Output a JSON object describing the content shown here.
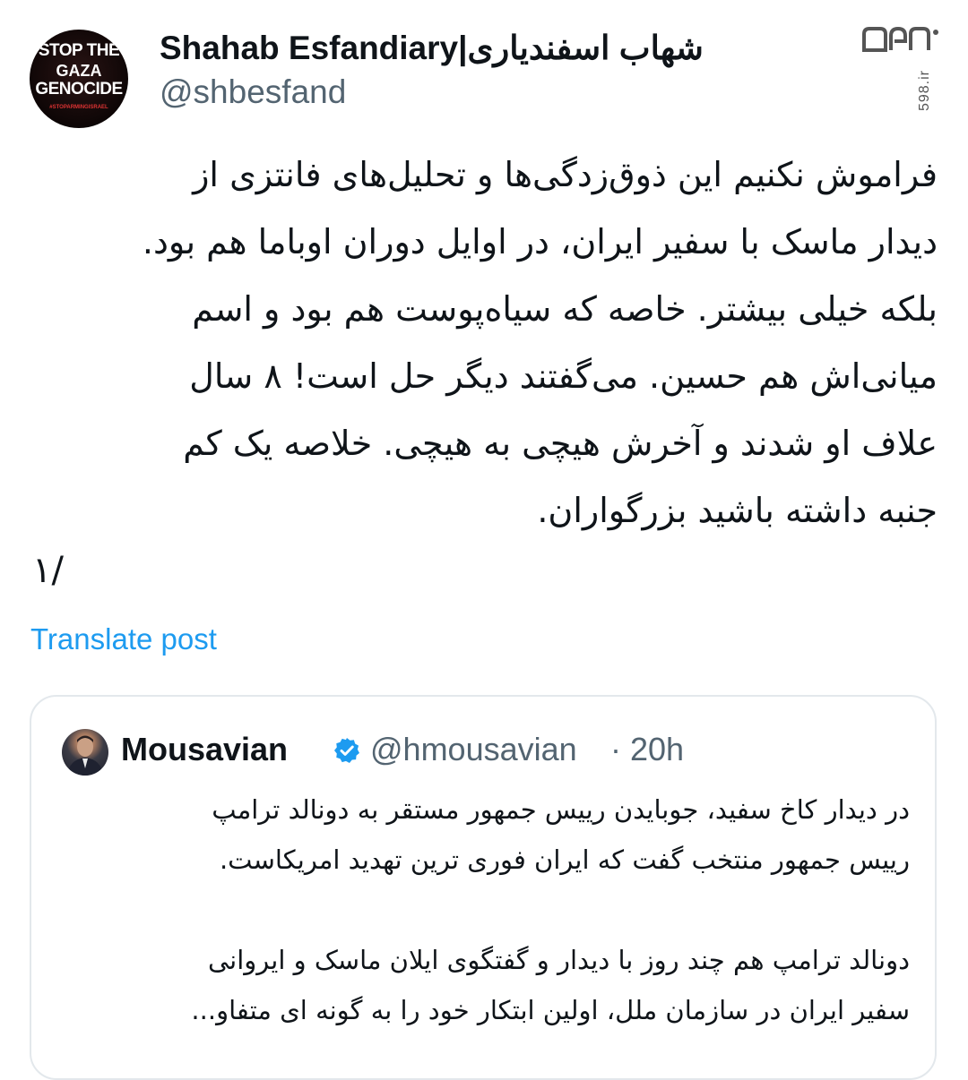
{
  "author": {
    "avatar_text": [
      "STOP THE",
      "GAZA",
      "GENOCIDE",
      "#STOPARMINGISRAEL"
    ],
    "display_name": "Shahab Esfandiary|شهاب اسفندیاری",
    "handle": "@shbesfand"
  },
  "watermark": {
    "site": "598.ir",
    "logo_name": "598-logo-icon"
  },
  "tweet": {
    "lines": [
      "فراموش نکنیم این ذوق‌زدگی‌ها و تحلیل‌های فانتزی از",
      "دیدار ماسک با سفیر ایران، در اوایل دوران اوباما هم بود.",
      "بلکه خیلی بیشتر. خاصه که سیاه‌پوست هم بود و اسم",
      "میانی‌اش هم حسین. می‌گفتند دیگر حل است! ۸ سال",
      "علاف او شدند و آخرش هیچی به هیچی. خلاصه یک کم",
      "جنبه داشته باشید بزرگواران."
    ],
    "thread_marker": "۱/",
    "translate_label": "Translate post"
  },
  "quoted": {
    "display_name": "Mousavian",
    "verified_icon": "verified-badge-icon",
    "handle": "@hmousavian",
    "time": "· 20h",
    "paragraph1": [
      "در دیدار کاخ سفید، جوبایدن رییس جمهور مستقر به دونالد ترامپ",
      "رییس جمهور منتخب گفت که ایران فوری ترین تهدید امریکاست."
    ],
    "paragraph2": [
      "دونالد ترامپ هم چند روز با دیدار و گفتگوی ایلان ماسک و ایروانی",
      "سفیر ایران در سازمان ملل، اولین ابتکار خود را به گونه ای متفاو..."
    ]
  },
  "colors": {
    "link": "#1d9bf0",
    "secondary_text": "#536471",
    "verified": "#1d9bf0",
    "border": "#e3e8ec"
  }
}
